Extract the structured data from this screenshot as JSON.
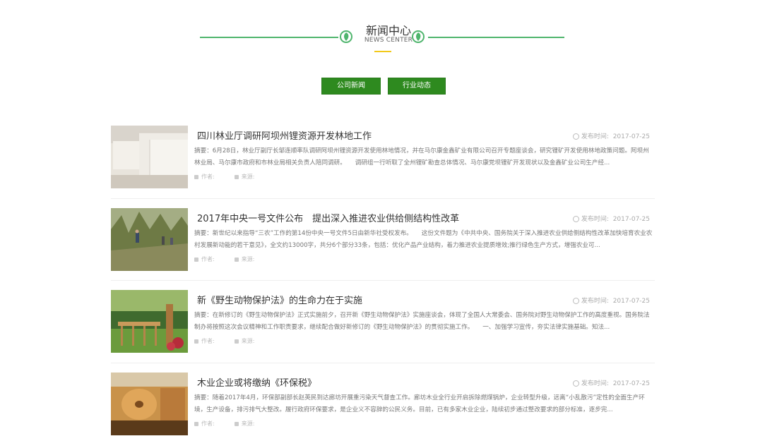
{
  "section": {
    "title": "新闻中心",
    "subtitle": "NEWS CENTER"
  },
  "tabs": [
    {
      "label": "公司新闻"
    },
    {
      "label": "行业动态"
    }
  ],
  "labels": {
    "date_prefix": "发布时间:",
    "author": "作者:",
    "source": "来源:"
  },
  "news": [
    {
      "title": "四川林业厅调研阿坝州锂资源开发林地工作",
      "date": "2017-07-25",
      "summary": "摘要：6月28日，林业厅副厅长邹连顺率队调研阿坝州锂资源开发使用林地情况，并在马尔康金鑫矿业有限公司召开专题座谈会，研究锂矿开发使用林地政策问题。阿坝州林业局、马尔康市政府和市林业局相关负责人陪同调研。　　调研组一行听取了全州锂矿勘查总体情况、马尔康党坝锂矿开发现状以及金鑫矿业公司生产经...",
      "thumb": "boards"
    },
    {
      "title": "2017年中央一号文件公布　提出深入推进农业供给侧结构性改革",
      "date": "2017-07-25",
      "summary": "摘要：新世纪以来指导“三农”工作的第14份中央一号文件5日由新华社受权发布。　　这份文件题为《中共中央、国务院关于深入推进农业供给侧结构性改革加快培育农业农村发展新动能的若干意见》，全文约13000字，共分6个部分33条，包括：优化产品产业结构，着力推进农业提质增效;推行绿色生产方式，增强农业可...",
      "thumb": "forest"
    },
    {
      "title": "新《野生动物保护法》的生命力在于实施",
      "date": "2017-07-25",
      "summary": "摘要：在新修订的《野生动物保护法》正式实施前夕，召开新《野生动物保护法》实施座谈会，体现了全国人大常委会、国务院对野生动物保护工作的高度重视。国务院法制办将按照这次会议精神和工作职责要求，继续配合做好新修订的《野生动物保护法》的贯彻实施工作。　　一、加强学习宣传，夯实法律实施基础。知法...",
      "thumb": "garden"
    },
    {
      "title": "木业企业或将缴纳《环保税》",
      "date": "2017-07-25",
      "summary": "摘要：随着2017年4月，环保部副部长赵英民到达廊坊开展重污染天气督查工作。廊坊木业全行业开启拆除燃煤锅炉，企业转型升级，远离“小乱散污”定性的全面生产环境，生产设备，排污排气大整改。履行政府环保要求，是企业义不容辞的公民义务。目前，已有多家木业企业，陆续初步通过整改要求的部分标准，逐步完...",
      "thumb": "factory"
    }
  ],
  "colors": {
    "accent_green": "#2e8a1f",
    "line_green": "#4fb56d",
    "underline_yellow": "#f2c91a"
  }
}
